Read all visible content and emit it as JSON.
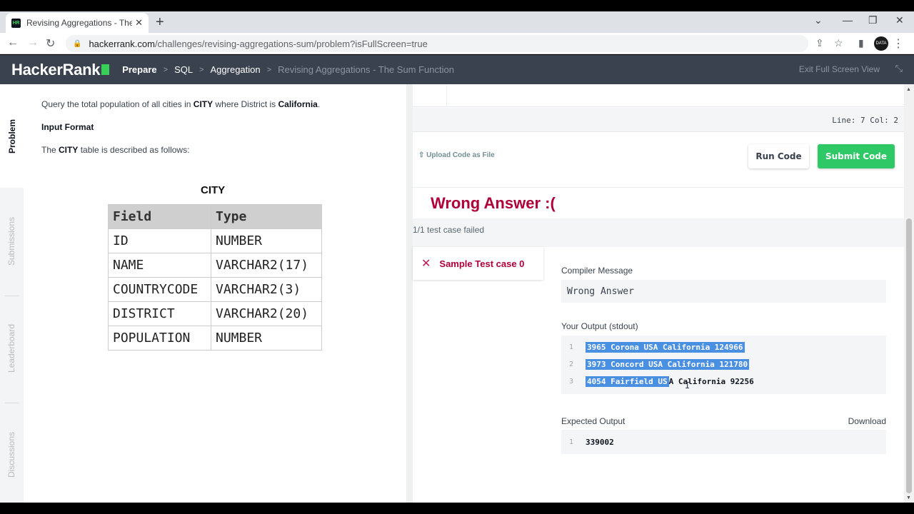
{
  "browser": {
    "tab_title": "Revising Aggregations - The Sum",
    "tab_favicon": "HR",
    "url_host": "hackerrank.com",
    "url_path": "/challenges/revising-aggregations-sum/problem?isFullScreen=true",
    "avatar_text": "DATA"
  },
  "header": {
    "logo": "HackerRank",
    "crumbs": [
      "Prepare",
      "SQL",
      "Aggregation",
      "Revising Aggregations - The Sum Function"
    ],
    "exit_fullscreen": "Exit Full Screen View"
  },
  "sidebar": {
    "tabs": [
      "Problem",
      "Submissions",
      "Leaderboard",
      "Discussions"
    ]
  },
  "problem": {
    "q_prefix": "Query the total population of all cities in ",
    "q_table": "CITY",
    "q_mid": " where District is ",
    "q_value": "California",
    "q_end": ".",
    "input_format": "Input Format",
    "desc_prefix": "The ",
    "desc_table": "CITY",
    "desc_suffix": " table is described as follows:",
    "table_title": "CITY",
    "columns": [
      "Field",
      "Type"
    ],
    "rows": [
      [
        "ID",
        "NUMBER"
      ],
      [
        "NAME",
        "VARCHAR2(17)"
      ],
      [
        "COUNTRYCODE",
        "VARCHAR2(3)"
      ],
      [
        "DISTRICT",
        "VARCHAR2(20)"
      ],
      [
        "POPULATION",
        "NUMBER"
      ]
    ]
  },
  "editor": {
    "status": "Line: 7  Col: 2",
    "upload": "Upload Code as File",
    "run": "Run Code",
    "submit": "Submit Code"
  },
  "result": {
    "heading": "Wrong Answer :(",
    "summary": "1/1 test case failed",
    "case_label": "Sample Test case 0",
    "compiler_label": "Compiler Message",
    "compiler_msg": "Wrong Answer",
    "output_label": "Your Output (stdout)",
    "output_lines": [
      {
        "n": "1",
        "text": "3965 Corona USA California 124966"
      },
      {
        "n": "2",
        "text": "3973 Concord USA California 121780"
      },
      {
        "n": "3",
        "sel": "4054 Fairfield US",
        "rest": "A California 92256"
      }
    ],
    "expected_label": "Expected Output",
    "download": "Download",
    "expected_lines": [
      {
        "n": "1",
        "text": "339002"
      }
    ]
  },
  "colors": {
    "accent_green": "#2ec866",
    "error_red": "#b0003a",
    "header_bg": "#39424e"
  }
}
